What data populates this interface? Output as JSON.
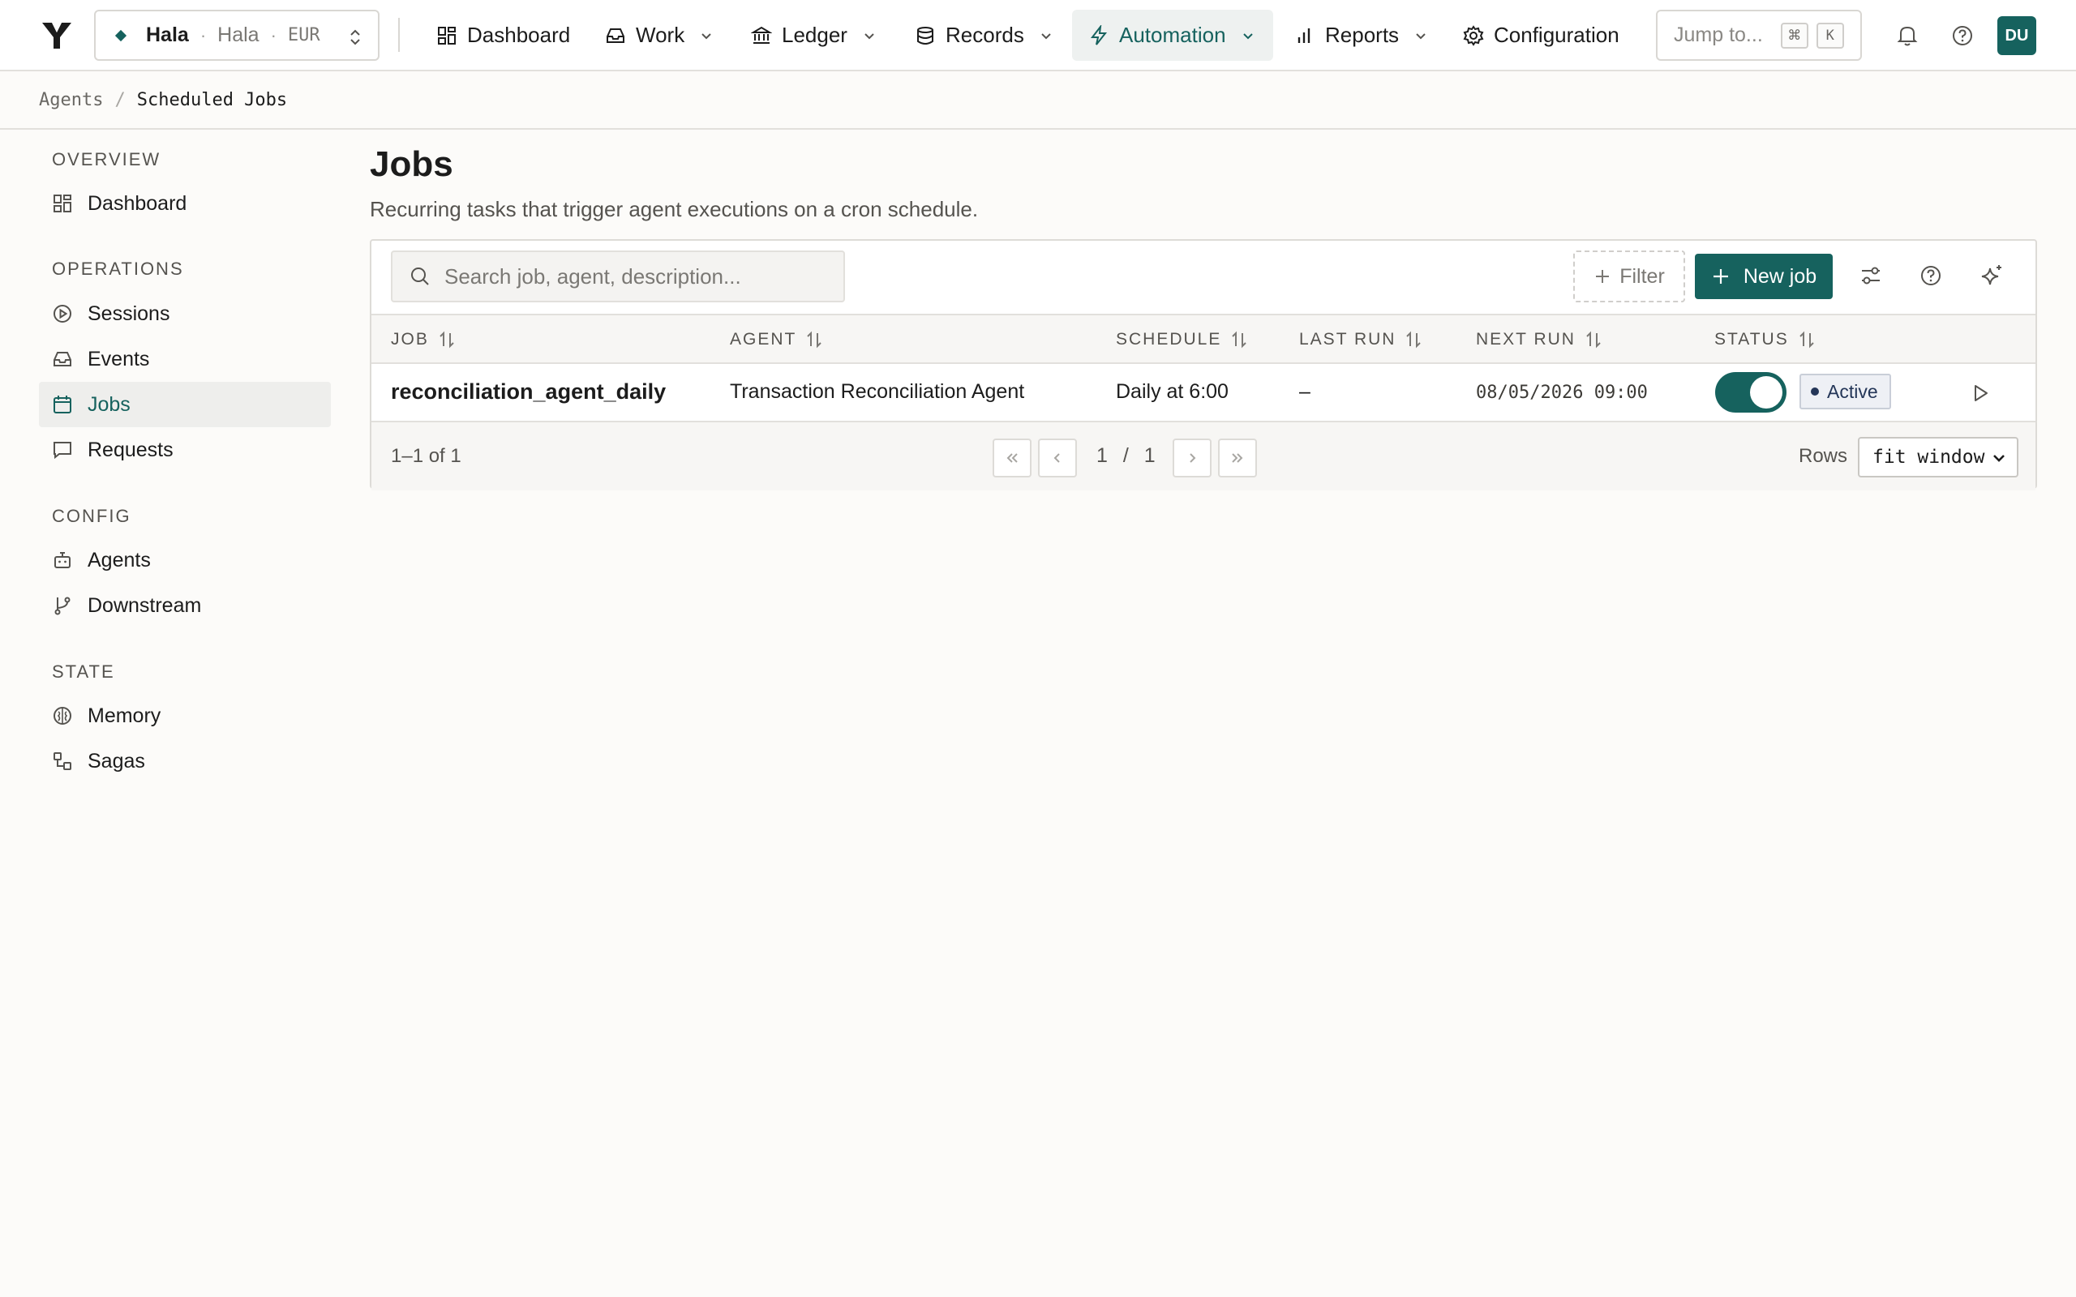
{
  "topbar": {
    "org": {
      "name": "Hala",
      "sub": "Hala",
      "currency": "EUR"
    },
    "nav": [
      {
        "label": "Dashboard"
      },
      {
        "label": "Work"
      },
      {
        "label": "Ledger"
      },
      {
        "label": "Records"
      },
      {
        "label": "Automation",
        "active": true
      },
      {
        "label": "Reports"
      },
      {
        "label": "Configuration"
      }
    ],
    "jump": {
      "placeholder": "Jump to...",
      "key1": "⌘",
      "key2": "K"
    },
    "avatar": "DU"
  },
  "breadcrumb": {
    "parent": "Agents",
    "sep": "/",
    "current": "Scheduled Jobs"
  },
  "sidebar": {
    "sections": [
      {
        "title": "OVERVIEW",
        "items": [
          {
            "label": "Dashboard"
          }
        ]
      },
      {
        "title": "OPERATIONS",
        "items": [
          {
            "label": "Sessions"
          },
          {
            "label": "Events"
          },
          {
            "label": "Jobs",
            "active": true
          },
          {
            "label": "Requests"
          }
        ]
      },
      {
        "title": "CONFIG",
        "items": [
          {
            "label": "Agents"
          },
          {
            "label": "Downstream"
          }
        ]
      },
      {
        "title": "STATE",
        "items": [
          {
            "label": "Memory"
          },
          {
            "label": "Sagas"
          }
        ]
      }
    ]
  },
  "main": {
    "title": "Jobs",
    "subtitle": "Recurring tasks that trigger agent executions on a cron schedule.",
    "search_placeholder": "Search job, agent, description...",
    "filter_label": "Filter",
    "new_job_label": "New job",
    "columns": [
      "JOB",
      "AGENT",
      "SCHEDULE",
      "LAST RUN",
      "NEXT RUN",
      "STATUS"
    ],
    "rows": [
      {
        "job": "reconciliation_agent_daily",
        "agent": "Transaction Reconciliation Agent",
        "schedule": "Daily at 6:00",
        "last_run": "–",
        "next_run": "08/05/2026 09:00",
        "enabled": true,
        "status": "Active"
      }
    ],
    "footer": {
      "range": "1–1 of 1",
      "page": "1",
      "page_sep": "/",
      "pages": "1",
      "rows_label": "Rows",
      "rows_value": "fit window"
    }
  },
  "colors": {
    "accent": "#16625e",
    "badge_text": "#243658",
    "background": "#fcfbf9"
  }
}
